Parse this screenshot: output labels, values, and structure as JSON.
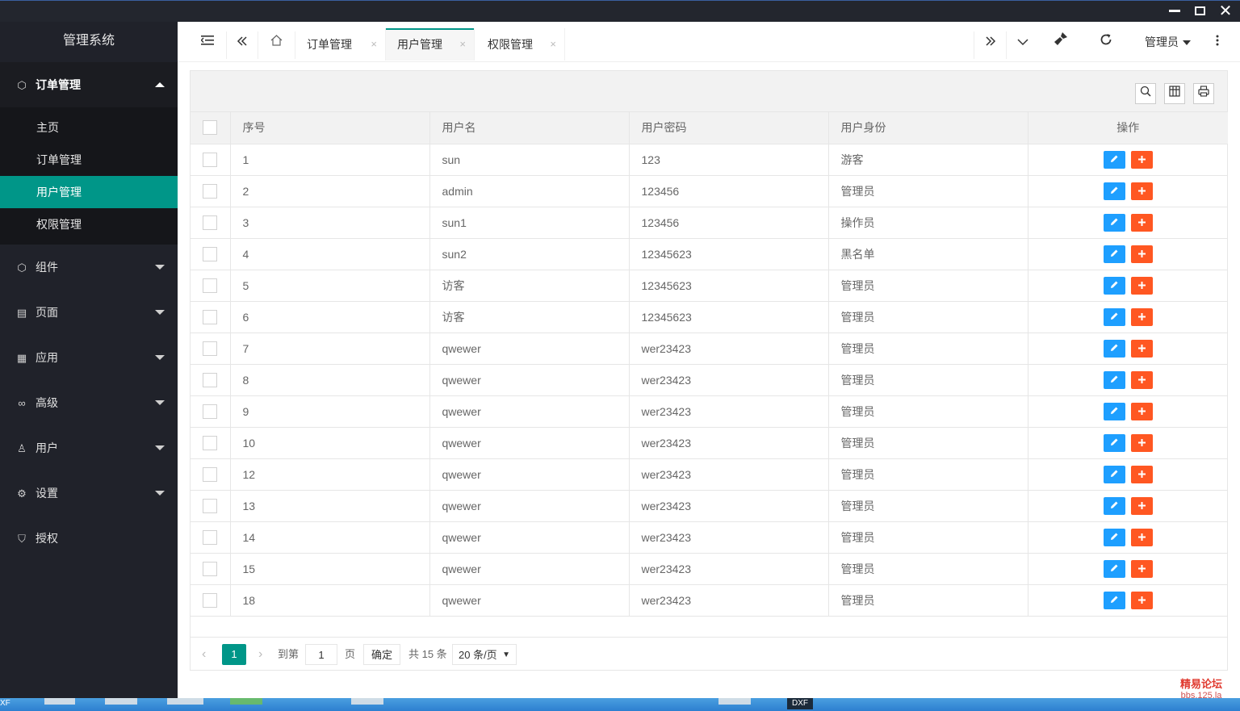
{
  "sidebar": {
    "app_title": "管理系统",
    "menu": [
      {
        "label": "订单管理",
        "icon": "cube-icon",
        "glyph": "⬡"
      },
      {
        "label": "组件",
        "icon": "cube-icon",
        "glyph": "⬡"
      },
      {
        "label": "页面",
        "icon": "page-icon",
        "glyph": "▤"
      },
      {
        "label": "应用",
        "icon": "apps-icon",
        "glyph": "▦"
      },
      {
        "label": "高级",
        "icon": "infinity-icon",
        "glyph": "∞"
      },
      {
        "label": "用户",
        "icon": "user-icon",
        "glyph": "♙"
      },
      {
        "label": "设置",
        "icon": "gear-icon",
        "glyph": "⚙"
      },
      {
        "label": "授权",
        "icon": "shield-icon",
        "glyph": "⛉"
      }
    ],
    "submenu": [
      "主页",
      "订单管理",
      "用户管理",
      "权限管理"
    ]
  },
  "header": {
    "tabs": [
      "订单管理",
      "用户管理",
      "权限管理"
    ],
    "active_tab": "用户管理",
    "user": "管理员",
    "close_glyph": "×"
  },
  "table": {
    "columns": [
      "序号",
      "用户名",
      "用户密码",
      "用户身份",
      "操作"
    ],
    "rows": [
      {
        "id": "1",
        "username": "sun",
        "password": "123",
        "role": "游客"
      },
      {
        "id": "2",
        "username": "admin",
        "password": "123456",
        "role": "管理员"
      },
      {
        "id": "3",
        "username": "sun1",
        "password": "123456",
        "role": "操作员"
      },
      {
        "id": "4",
        "username": "sun2",
        "password": "12345623",
        "role": "黑名单"
      },
      {
        "id": "5",
        "username": "访客",
        "password": "12345623",
        "role": "管理员"
      },
      {
        "id": "6",
        "username": "访客",
        "password": "12345623",
        "role": "管理员"
      },
      {
        "id": "7",
        "username": "qwewer",
        "password": "wer23423",
        "role": "管理员"
      },
      {
        "id": "8",
        "username": "qwewer",
        "password": "wer23423",
        "role": "管理员"
      },
      {
        "id": "9",
        "username": "qwewer",
        "password": "wer23423",
        "role": "管理员"
      },
      {
        "id": "10",
        "username": "qwewer",
        "password": "wer23423",
        "role": "管理员"
      },
      {
        "id": "12",
        "username": "qwewer",
        "password": "wer23423",
        "role": "管理员"
      },
      {
        "id": "13",
        "username": "qwewer",
        "password": "wer23423",
        "role": "管理员"
      },
      {
        "id": "14",
        "username": "qwewer",
        "password": "wer23423",
        "role": "管理员"
      },
      {
        "id": "15",
        "username": "qwewer",
        "password": "wer23423",
        "role": "管理员"
      },
      {
        "id": "18",
        "username": "qwewer",
        "password": "wer23423",
        "role": "管理员"
      }
    ]
  },
  "pager": {
    "current_page": "1",
    "goto_label": "到第",
    "goto_value": "1",
    "page_unit": "页",
    "confirm": "确定",
    "total": "共 15 条",
    "page_size": "20 条/页"
  },
  "taskbar": {
    "left_text": "XF",
    "app_text": "DXF"
  },
  "watermark": {
    "name": "精易论坛",
    "site": "bbs.125.la"
  },
  "colors": {
    "accent": "#009688",
    "sidebar_bg": "#20222a",
    "edit_button": "#1e9fff",
    "add_button": "#ff5722"
  }
}
